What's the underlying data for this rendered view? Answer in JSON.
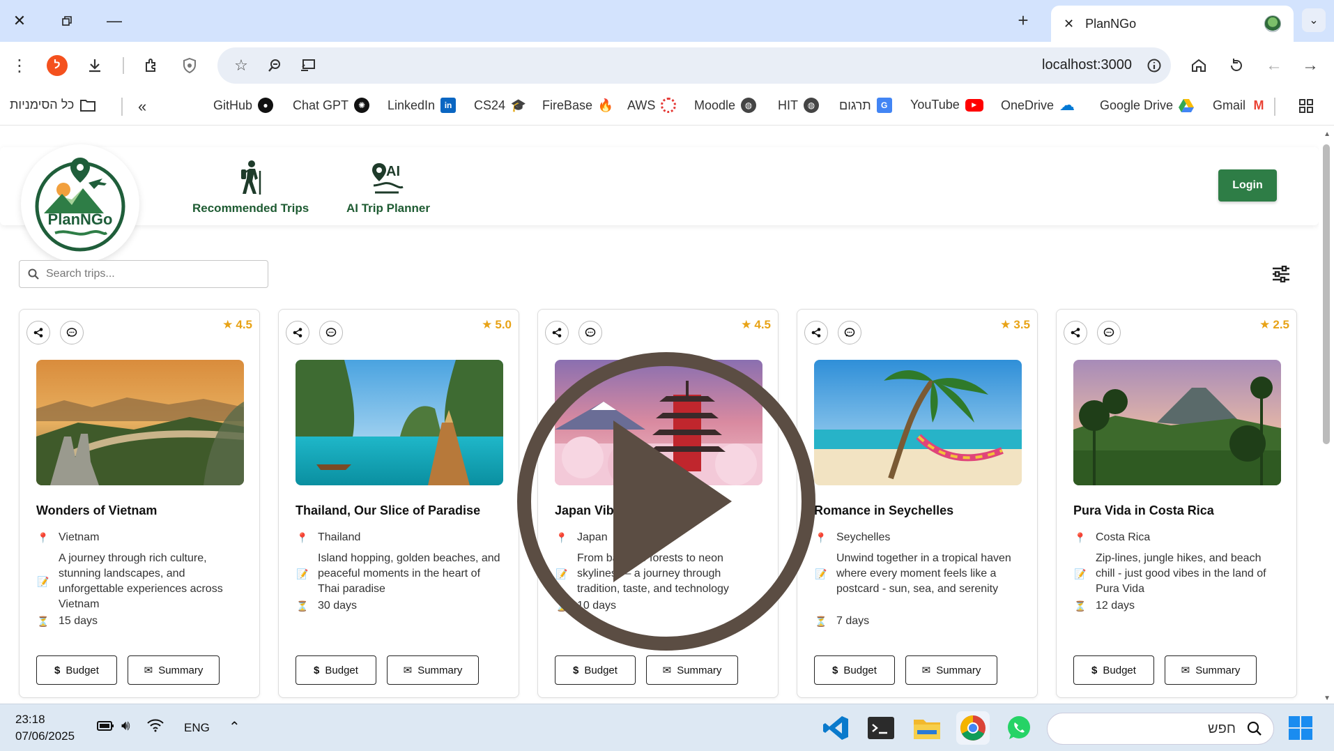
{
  "browser": {
    "tab_title": "PlanNGo",
    "url": "localhost:3000",
    "bookmarks_folder_label": "כל הסימניות",
    "bookmarks": [
      {
        "label": "GitHub"
      },
      {
        "label": "Chat GPT"
      },
      {
        "label": "LinkedIn"
      },
      {
        "label": "CS24"
      },
      {
        "label": "FireBase"
      },
      {
        "label": "AWS"
      },
      {
        "label": "Moodle"
      },
      {
        "label": "HIT"
      },
      {
        "label": "תרגום"
      },
      {
        "label": "YouTube"
      },
      {
        "label": "OneDrive"
      },
      {
        "label": "Google Drive"
      },
      {
        "label": "Gmail"
      }
    ]
  },
  "header": {
    "logo_text": "PlanNGo",
    "nav": [
      {
        "label": "Recommended Trips",
        "icon": "hiker-icon"
      },
      {
        "label": "AI Trip Planner",
        "icon": "ai-location-icon"
      }
    ],
    "login_label": "Login"
  },
  "search": {
    "placeholder": "Search trips..."
  },
  "cards": [
    {
      "title": "Wonders of Vietnam",
      "rating": "4.5",
      "location": "Vietnam",
      "description": "A journey through rich culture, stunning landscapes, and unforgettable experiences across Vietnam",
      "duration": "15 days",
      "budget_label": "Budget",
      "summary_label": "Summary"
    },
    {
      "title": "Thailand, Our Slice of Paradise",
      "rating": "5.0",
      "location": "Thailand",
      "description": "Island hopping, golden beaches, and peaceful moments in the heart of Thai paradise",
      "duration": "30 days",
      "budget_label": "Budget",
      "summary_label": "Summary"
    },
    {
      "title": "Japan Vibes Only",
      "rating": "4.5",
      "location": "Japan",
      "description": "From bamboo forests to neon skylines — a journey through tradition, taste, and technology",
      "duration": "10 days",
      "budget_label": "Budget",
      "summary_label": "Summary"
    },
    {
      "title": "Romance in Seychelles",
      "rating": "3.5",
      "location": "Seychelles",
      "description": "Unwind together in a tropical haven where every moment feels like a postcard - sun, sea, and serenity",
      "duration": "7 days",
      "budget_label": "Budget",
      "summary_label": "Summary"
    },
    {
      "title": "Pura Vida in Costa Rica",
      "rating": "2.5",
      "location": "Costa Rica",
      "description": "Zip-lines, jungle hikes, and beach chill - just good vibes in the land of Pura Vida",
      "duration": "12 days",
      "budget_label": "Budget",
      "summary_label": "Summary"
    }
  ],
  "taskbar": {
    "time": "23:18",
    "date": "07/06/2025",
    "language": "ENG",
    "search_placeholder": "חפש"
  },
  "colors": {
    "brand_green": "#2e7d46",
    "nav_green": "#1e5b32",
    "star": "#e8a317"
  }
}
